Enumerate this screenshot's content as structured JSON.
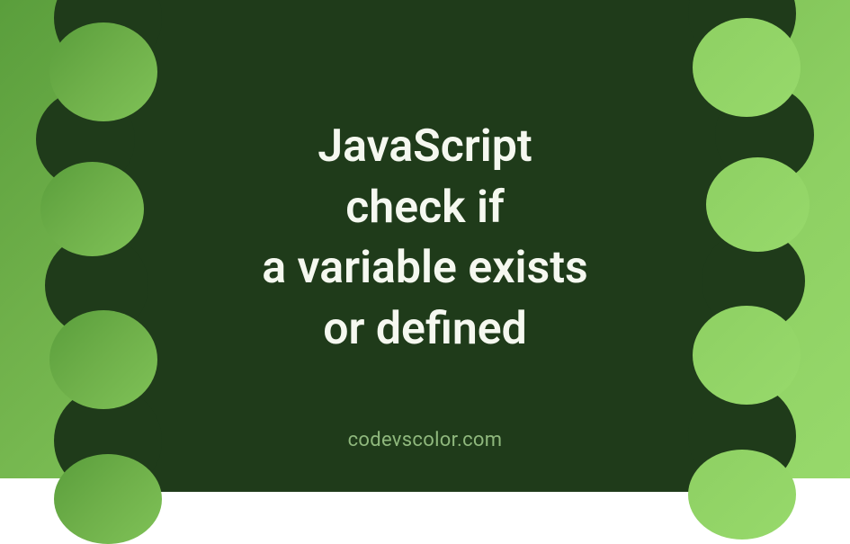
{
  "title_line1": "JavaScript",
  "title_line2": "check if",
  "title_line3": "a variable exists",
  "title_line4": "or defined",
  "watermark": "codevscolor.com",
  "colors": {
    "blob": "#1f3b1a",
    "gradient_start": "#5a9e3c",
    "gradient_end": "#97d96b",
    "text": "#f5f8f0",
    "watermark": "#8fb87d"
  }
}
